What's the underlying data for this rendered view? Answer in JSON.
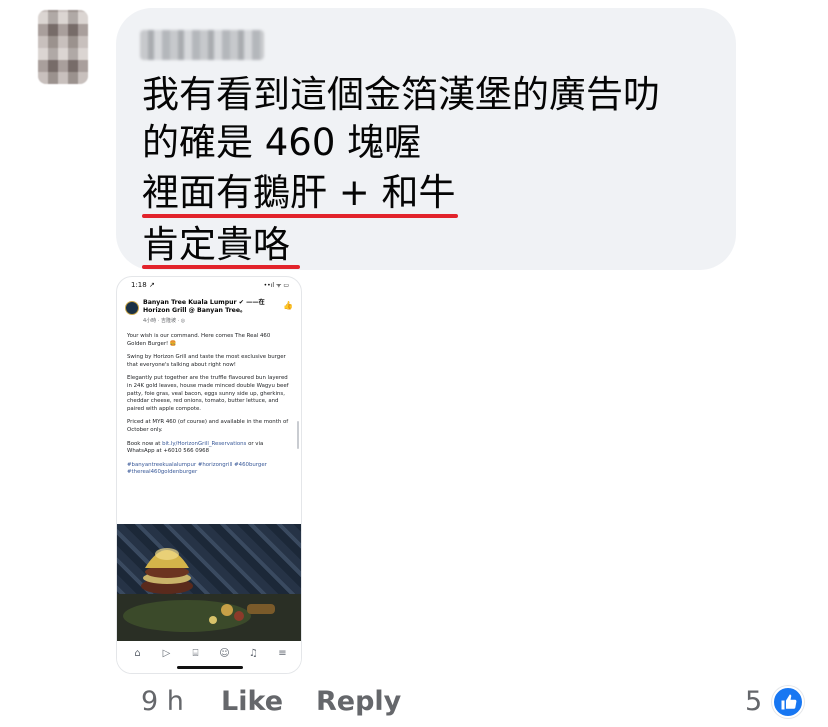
{
  "comment": {
    "text_lines": [
      "我有看到這個金箔漢堡的廣告叻",
      "的確是 460 塊喔",
      "裡面有鵝肝 + 和牛",
      "肯定貴咯"
    ]
  },
  "attachment": {
    "status_time": "1:18 ↗",
    "status_icons": "••ıl ᯤ ▭",
    "page_title": "Banyan Tree Kuala Lumpur ✔ ——在 Horizon Grill @ Banyan Tree。",
    "page_sub": "4小時 · 吉隆坡 · ◎",
    "paragraphs": [
      "Your wish is our command. Here comes The Real 460 Golden Burger! 🍔",
      "Swing by Horizon Grill and taste the most exclusive burger that everyone's talking about right now!",
      "Elegantly put together are the truffle flavoured bun layered in 24K gold leaves, house made minced double Wagyu beef patty, foie gras, veal bacon, eggs sunny side up, gherkins, cheddar cheese, red onions, tomato, butter lettuce, and paired with apple compote.",
      "Priced at MYR 460 (of course) and available in the month of October only."
    ],
    "book_text": "Book now at",
    "book_link": "bit.ly/HorizonGrill_Reservations",
    "book_text2": "or via WhatsApp at +6010 566 0968",
    "hashtags": "#banyantreekualalumpur #horizongrill #460burger #thereal460goldenburger",
    "nav_icons": [
      "home-icon",
      "video-icon",
      "marketplace-icon",
      "groups-icon",
      "bell-icon",
      "menu-icon"
    ]
  },
  "actions": {
    "time": "9 h",
    "like": "Like",
    "reply": "Reply",
    "reaction_count": "5"
  },
  "colors": {
    "bubble": "#f0f2f5",
    "underline": "#e2232b",
    "like_blue": "#1877f2",
    "meta_gray": "#65676b"
  }
}
